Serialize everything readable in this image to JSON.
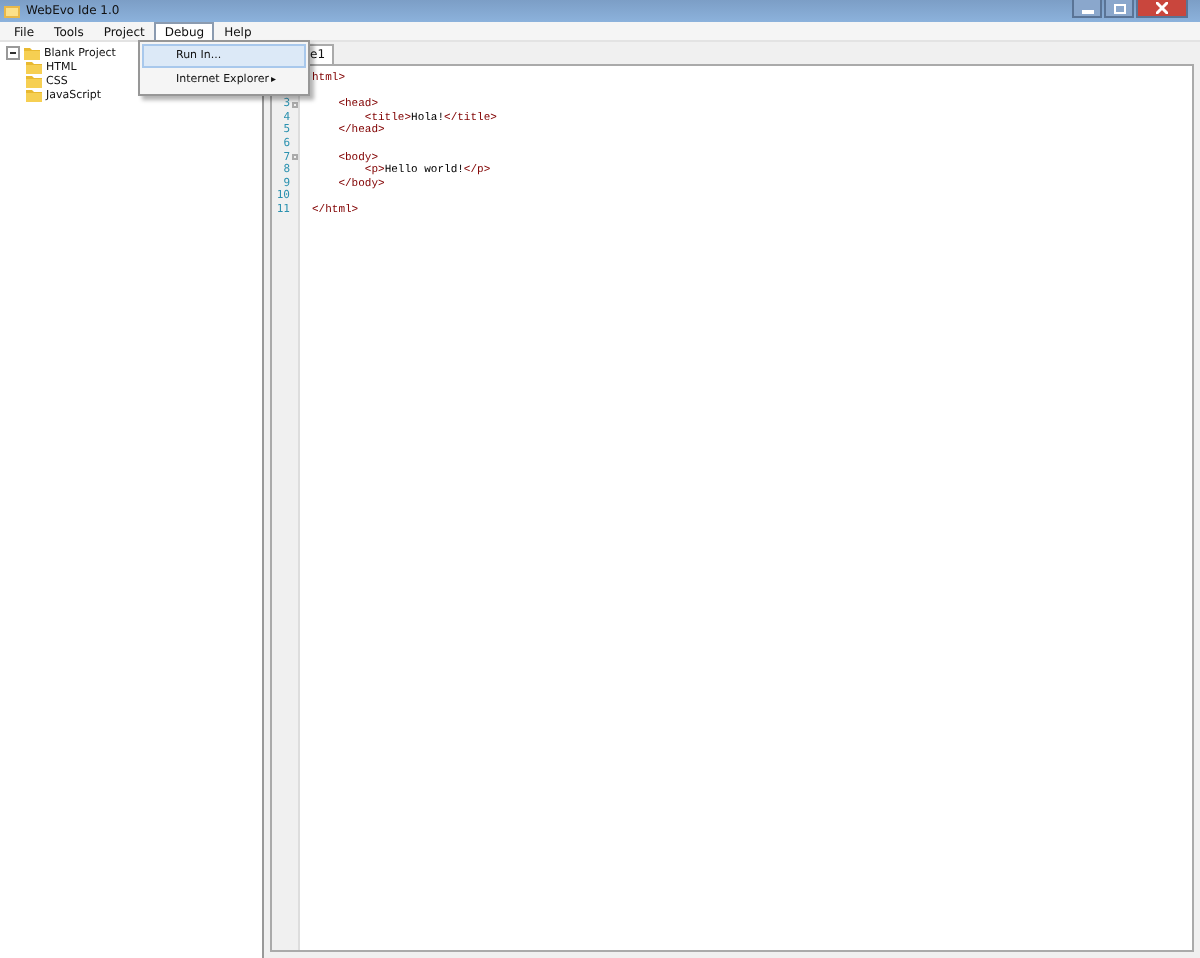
{
  "window": {
    "title": "WebEvo Ide 1.0"
  },
  "menu_bar": [
    {
      "label": "File",
      "selected": false
    },
    {
      "label": "Tools",
      "selected": false
    },
    {
      "label": "Project",
      "selected": false
    },
    {
      "label": "Debug",
      "selected": true
    },
    {
      "label": "Help",
      "selected": false
    }
  ],
  "dropdown": [
    {
      "label": "Run In...",
      "selected": true,
      "submenu": false
    },
    {
      "label": "Internet Explorer",
      "selected": false,
      "submenu": true,
      "arrow": "▸"
    }
  ],
  "tree": [
    {
      "label": "Blank Project",
      "expanded": true,
      "children": [
        {
          "label": "HTML"
        },
        {
          "label": "CSS"
        },
        {
          "label": "JavaScript"
        }
      ]
    }
  ],
  "tabs": [
    {
      "label": "e1",
      "selected": true
    }
  ],
  "code_lines": [
    {
      "segments": [
        {
          "kind": "tag",
          "text": "html>"
        }
      ]
    },
    {
      "number": "3",
      "fold": true,
      "segments": [
        {
          "kind": "tag",
          "text": "    <head>"
        }
      ]
    },
    {
      "number": "4",
      "fold": false,
      "segments": [
        {
          "kind": "tag",
          "text": "        <title>"
        },
        {
          "kind": "text",
          "text": "Hola!"
        },
        {
          "kind": "tag",
          "text": "</title>"
        }
      ]
    },
    {
      "number": "5",
      "fold": false,
      "segments": [
        {
          "kind": "tag",
          "text": "    </head>"
        }
      ]
    },
    {
      "number": "6",
      "fold": false
    },
    {
      "number": "7",
      "fold": true,
      "segments": [
        {
          "kind": "tag",
          "text": "    <body>"
        }
      ]
    },
    {
      "number": "8",
      "fold": false,
      "segments": [
        {
          "kind": "tag",
          "text": "        <p>"
        },
        {
          "kind": "text",
          "text": "Hello world!"
        },
        {
          "kind": "tag",
          "text": "</p>"
        }
      ]
    },
    {
      "number": "9",
      "fold": false,
      "segments": [
        {
          "kind": "tag",
          "text": "    </body>"
        }
      ]
    },
    {
      "number": "10",
      "fold": false
    },
    {
      "number": "11",
      "fold": false,
      "segments": [
        {
          "kind": "tag",
          "text": "</html>"
        }
      ]
    }
  ]
}
